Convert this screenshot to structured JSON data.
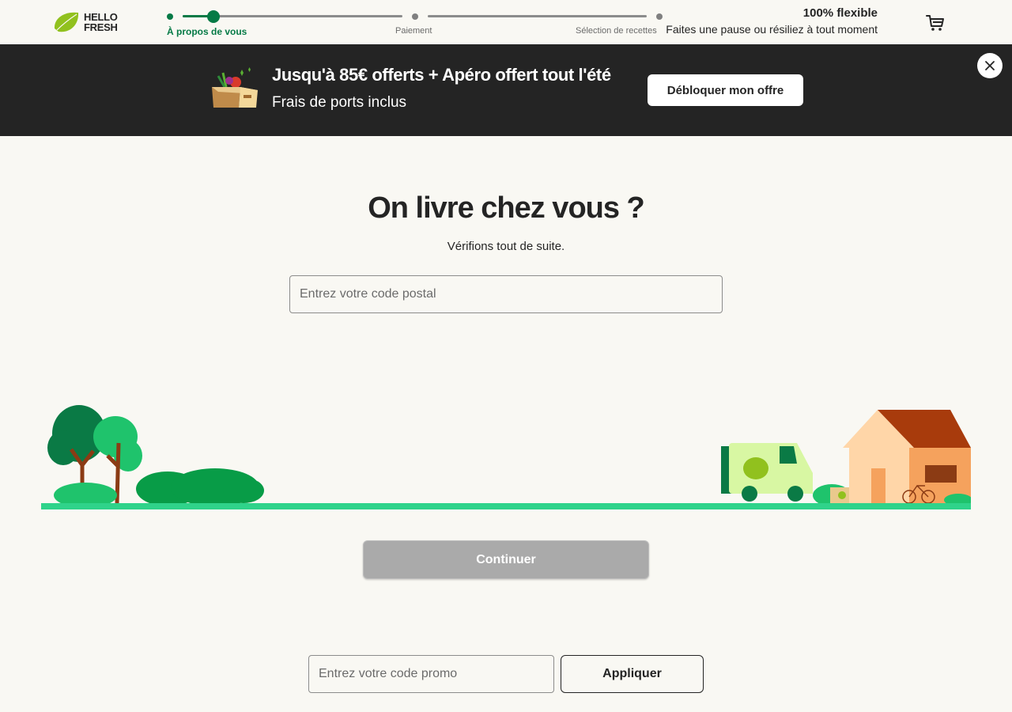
{
  "header": {
    "logo_text_line1": "HELLO",
    "logo_text_line2": "FRESH",
    "steps": [
      {
        "label": "À propos de vous",
        "state": "active"
      },
      {
        "label": "Paiement",
        "state": "todo"
      },
      {
        "label": "Sélection de recettes",
        "state": "todo"
      }
    ],
    "flexible_title": "100% flexible",
    "flexible_subtitle": "Faites une pause ou résiliez à tout moment",
    "cart_icon": "cart-icon"
  },
  "banner": {
    "title": "Jusqu'à 85€ offerts + Apéro offert tout l'été",
    "subtitle": "Frais de ports inclus",
    "cta_label": "Débloquer mon offre",
    "close_icon": "close-icon",
    "image_icon": "food-box-icon"
  },
  "main": {
    "title": "On livre chez vous ?",
    "subtitle": "Vérifions tout de suite.",
    "postal_placeholder": "Entrez votre code postal",
    "postal_value": "",
    "continue_label": "Continuer",
    "continue_disabled": true,
    "promo_placeholder": "Entrez votre code promo",
    "promo_value": "",
    "apply_label": "Appliquer"
  },
  "colors": {
    "brand_green": "#067a46",
    "banner_bg": "#242424",
    "page_bg": "#f9f8f3",
    "disabled_button": "#aaaaaa"
  }
}
